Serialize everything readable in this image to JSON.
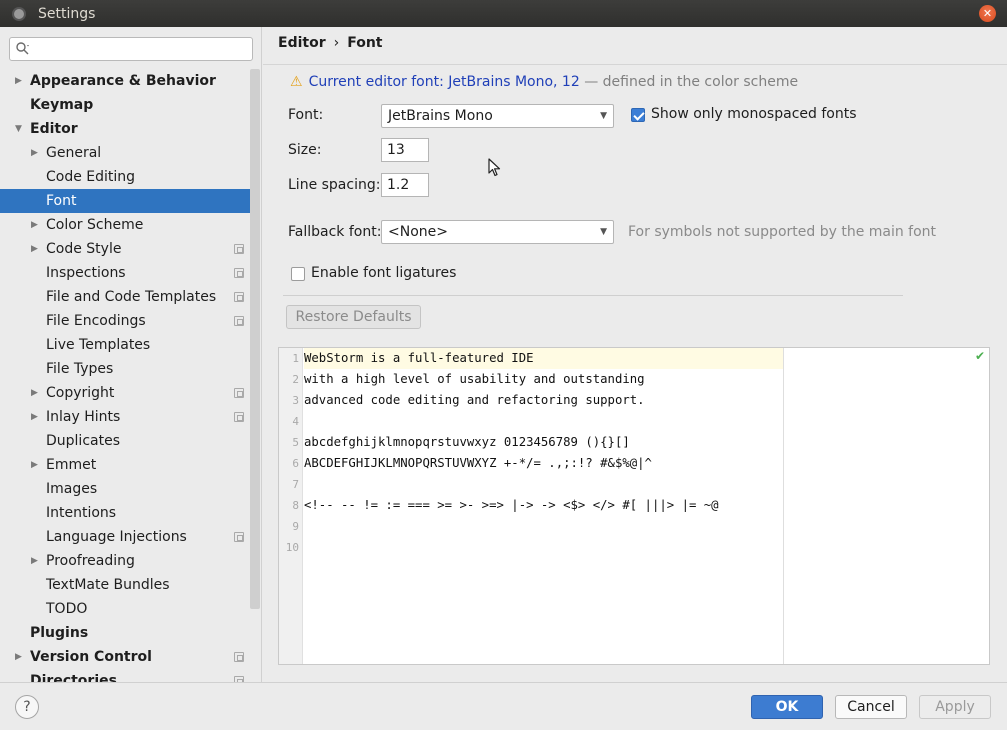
{
  "window": {
    "title": "Settings"
  },
  "search": {
    "placeholder": ""
  },
  "sidebar": {
    "items": [
      {
        "label": "Appearance & Behavior",
        "level": 0,
        "arrow": "▶",
        "project": false,
        "selected": false
      },
      {
        "label": "Keymap",
        "level": 0,
        "arrow": "",
        "project": false,
        "selected": false
      },
      {
        "label": "Editor",
        "level": 0,
        "arrow": "▼",
        "project": false,
        "selected": false
      },
      {
        "label": "General",
        "level": 1,
        "arrow": "▶",
        "project": false,
        "selected": false
      },
      {
        "label": "Code Editing",
        "level": 1,
        "arrow": "",
        "project": false,
        "selected": false
      },
      {
        "label": "Font",
        "level": 1,
        "arrow": "",
        "project": false,
        "selected": true
      },
      {
        "label": "Color Scheme",
        "level": 1,
        "arrow": "▶",
        "project": false,
        "selected": false
      },
      {
        "label": "Code Style",
        "level": 1,
        "arrow": "▶",
        "project": true,
        "selected": false
      },
      {
        "label": "Inspections",
        "level": 1,
        "arrow": "",
        "project": true,
        "selected": false
      },
      {
        "label": "File and Code Templates",
        "level": 1,
        "arrow": "",
        "project": true,
        "selected": false
      },
      {
        "label": "File Encodings",
        "level": 1,
        "arrow": "",
        "project": true,
        "selected": false
      },
      {
        "label": "Live Templates",
        "level": 1,
        "arrow": "",
        "project": false,
        "selected": false
      },
      {
        "label": "File Types",
        "level": 1,
        "arrow": "",
        "project": false,
        "selected": false
      },
      {
        "label": "Copyright",
        "level": 1,
        "arrow": "▶",
        "project": true,
        "selected": false
      },
      {
        "label": "Inlay Hints",
        "level": 1,
        "arrow": "▶",
        "project": true,
        "selected": false
      },
      {
        "label": "Duplicates",
        "level": 1,
        "arrow": "",
        "project": false,
        "selected": false
      },
      {
        "label": "Emmet",
        "level": 1,
        "arrow": "▶",
        "project": false,
        "selected": false
      },
      {
        "label": "Images",
        "level": 1,
        "arrow": "",
        "project": false,
        "selected": false
      },
      {
        "label": "Intentions",
        "level": 1,
        "arrow": "",
        "project": false,
        "selected": false
      },
      {
        "label": "Language Injections",
        "level": 1,
        "arrow": "",
        "project": true,
        "selected": false
      },
      {
        "label": "Proofreading",
        "level": 1,
        "arrow": "▶",
        "project": false,
        "selected": false
      },
      {
        "label": "TextMate Bundles",
        "level": 1,
        "arrow": "",
        "project": false,
        "selected": false
      },
      {
        "label": "TODO",
        "level": 1,
        "arrow": "",
        "project": false,
        "selected": false
      },
      {
        "label": "Plugins",
        "level": 0,
        "arrow": "",
        "project": false,
        "selected": false
      },
      {
        "label": "Version Control",
        "level": 0,
        "arrow": "▶",
        "project": true,
        "selected": false
      },
      {
        "label": "Directories",
        "level": 0,
        "arrow": "",
        "project": true,
        "selected": false
      }
    ]
  },
  "breadcrumb": {
    "parent": "Editor",
    "separator": "›",
    "current": "Font"
  },
  "notice": {
    "icon": "warning-icon",
    "link_text": "Current editor font: JetBrains Mono, 12",
    "suffix": " — defined in the color scheme"
  },
  "form": {
    "font_label": "Font:",
    "font_value": "JetBrains Mono",
    "monospaced_label": "Show only monospaced fonts",
    "monospaced_checked": true,
    "size_label": "Size:",
    "size_value": "13",
    "line_spacing_label": "Line spacing:",
    "line_spacing_value": "1.2",
    "fallback_label": "Fallback font:",
    "fallback_value": "<None>",
    "fallback_hint": "For symbols not supported by the main font",
    "ligatures_label": "Enable font ligatures",
    "ligatures_checked": false,
    "restore_label": "Restore Defaults"
  },
  "preview": {
    "lines": [
      {
        "n": "1",
        "text": "WebStorm is a full-featured IDE"
      },
      {
        "n": "2",
        "text": "with a high level of usability and outstanding"
      },
      {
        "n": "3",
        "text": "advanced code editing and refactoring support."
      },
      {
        "n": "4",
        "text": ""
      },
      {
        "n": "5",
        "text": "abcdefghijklmnopqrstuvwxyz 0123456789 (){}[]"
      },
      {
        "n": "6",
        "text": "ABCDEFGHIJKLMNOPQRSTUVWXYZ +-*/= .,;:!? #&$%@|^"
      },
      {
        "n": "7",
        "text": ""
      },
      {
        "n": "8",
        "text": "<!-- -- != := === >= >- >=> |-> -> <$> </> #[ |||> |= ~@"
      },
      {
        "n": "9",
        "text": ""
      },
      {
        "n": "10",
        "text": ""
      }
    ],
    "status_mark": "✔"
  },
  "footer": {
    "help": "?",
    "ok": "OK",
    "cancel": "Cancel",
    "apply": "Apply"
  },
  "colors": {
    "accent": "#2f74c0",
    "ok_button": "#3d7cd1",
    "warning": "#e4a11b",
    "link": "#2040b8"
  }
}
